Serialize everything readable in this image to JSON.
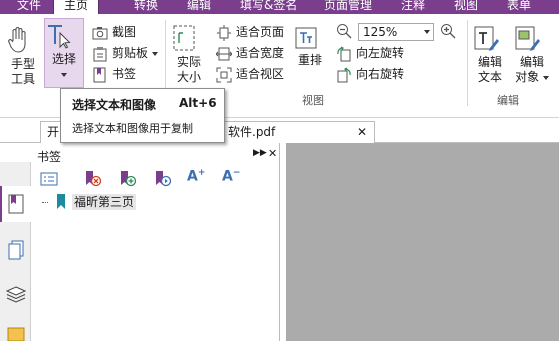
{
  "menu": {
    "tabs": [
      {
        "label": "文件"
      },
      {
        "label": "主页"
      },
      {
        "label": "转换"
      },
      {
        "label": "编辑"
      },
      {
        "label": "填写&签名"
      },
      {
        "label": "页面管理"
      },
      {
        "label": "注释"
      },
      {
        "label": "视图"
      },
      {
        "label": "表单"
      }
    ],
    "active": "主页"
  },
  "ribbon": {
    "hand_tool": "手型\n工具",
    "hand_tool_l1": "手型",
    "hand_tool_l2": "工具",
    "select_l1": "选择",
    "screenshot": "截图",
    "clipboard": "剪贴板",
    "bookmark": "书签",
    "actual_size_l1": "实际",
    "actual_size_l2": "大小",
    "fit_page": "适合页面",
    "fit_width": "适合宽度",
    "fit_visible": "适合视区",
    "reflow": "重排",
    "zoom_value": "125%",
    "rotate_left": "向左旋转",
    "rotate_right": "向右旋转",
    "view_group": "视图",
    "edit_text_l1": "编辑",
    "edit_text_l2": "文本",
    "edit_object_l1": "编辑",
    "edit_object_l2": "对象",
    "edit_group": "编辑"
  },
  "tooltip": {
    "title": "选择文本和图像",
    "shortcut": "Alt+6",
    "description": "选择文本和图像用于复制"
  },
  "doc_tabs": {
    "tab1_partial": "开",
    "tab2_partial": "软件.pdf"
  },
  "bookmarks": {
    "title": "书签",
    "items": [
      {
        "label": "福昕第三页"
      }
    ]
  },
  "colors": {
    "menubar": "#7a3e8c",
    "accent": "#6b2f80",
    "doc_background": "#ababab"
  }
}
